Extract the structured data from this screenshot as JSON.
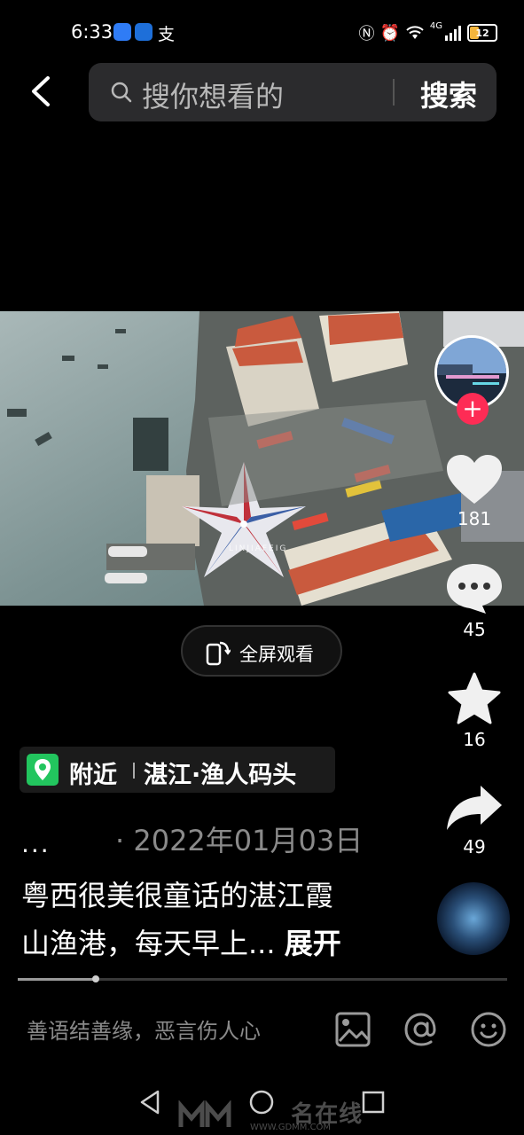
{
  "status_bar": {
    "time": "6:33",
    "battery_level": "12",
    "network": "4G"
  },
  "header": {
    "search_placeholder": "搜你想看的",
    "search_button": "搜索"
  },
  "video": {
    "watermark_text": "LINJIAFEIG",
    "fullscreen_label": "全屏观看"
  },
  "actions": {
    "likes": "181",
    "comments": "45",
    "favorites": "16",
    "shares": "49"
  },
  "location": {
    "nearby": "附近",
    "place": "湛江·渔人码头"
  },
  "post": {
    "author": "...",
    "date": "· 2022年01月03日",
    "caption_line1": "粤西很美很童话的湛江霞",
    "caption_line2": "山渔港，每天早上...",
    "expand": "展开"
  },
  "playback": {
    "progress_fraction": 0.16
  },
  "comment_bar": {
    "placeholder": "善语结善缘，恶言伤人心"
  },
  "watermark": {
    "main": "名在线",
    "url": "WWW.GDMM.COM"
  },
  "colors": {
    "accent_red": "#fe2c55",
    "location_green": "#22c55e",
    "battery_yellow": "#f3b53c"
  }
}
